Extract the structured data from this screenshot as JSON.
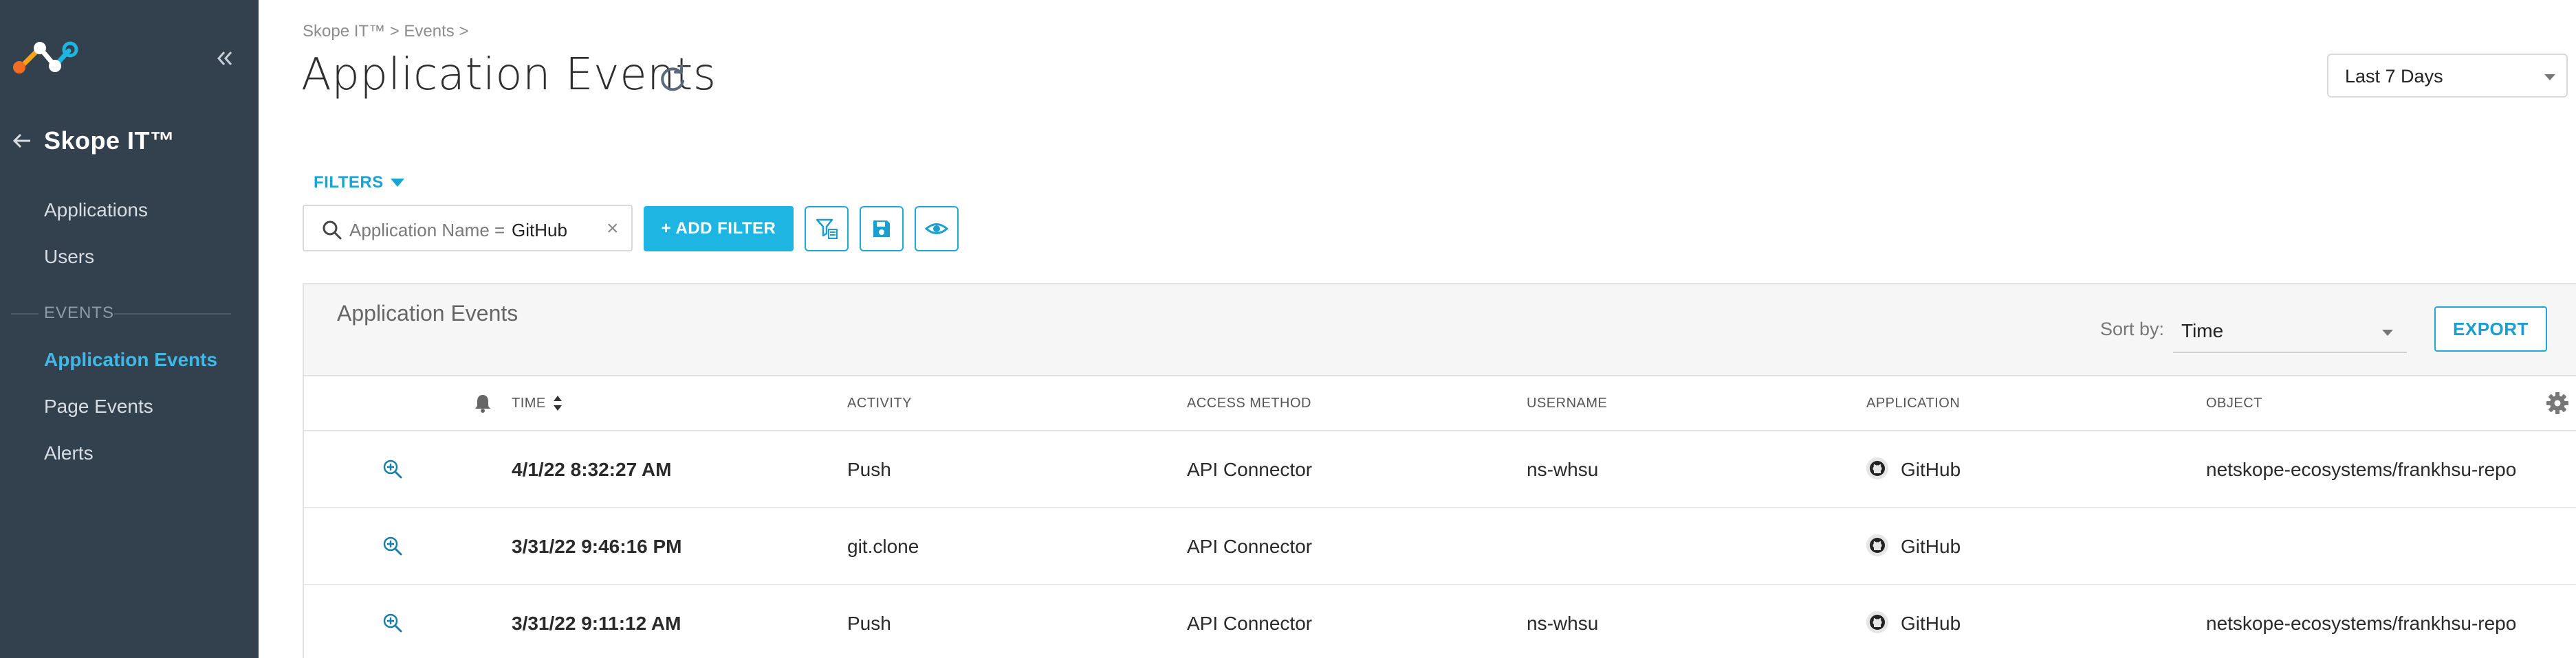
{
  "sidebar": {
    "back_title": "Skope IT™",
    "items_top": [
      {
        "label": "Applications"
      },
      {
        "label": "Users"
      }
    ],
    "section_label": "EVENTS",
    "items_events": [
      {
        "label": "Application Events",
        "active": true
      },
      {
        "label": "Page Events",
        "active": false
      },
      {
        "label": "Alerts",
        "active": false
      }
    ]
  },
  "header": {
    "breadcrumb": "Skope IT™ > Events >",
    "title": "Application Events",
    "range": "Last 7 Days"
  },
  "filters": {
    "toggle_label": "FILTERS",
    "chip_key": "Application Name =",
    "chip_value": "GitHub",
    "chip_close": "×",
    "add_label": "+ ADD FILTER"
  },
  "panel": {
    "title": "Application Events",
    "sort_label": "Sort by:",
    "sort_value": "Time",
    "export_label": "EXPORT",
    "columns": [
      "TIME",
      "ACTIVITY",
      "ACCESS METHOD",
      "USERNAME",
      "APPLICATION",
      "OBJECT"
    ],
    "rows": [
      {
        "time": "4/1/22 8:32:27 AM",
        "activity": "Push",
        "access": "API Connector",
        "username": "ns-whsu",
        "application": "GitHub",
        "object": "netskope-ecosystems/frankhsu-repo"
      },
      {
        "time": "3/31/22 9:46:16 PM",
        "activity": "git.clone",
        "access": "API Connector",
        "username": "",
        "application": "GitHub",
        "object": ""
      },
      {
        "time": "3/31/22 9:11:12 AM",
        "activity": "Push",
        "access": "API Connector",
        "username": "ns-whsu",
        "application": "GitHub",
        "object": "netskope-ecosystems/frankhsu-repo"
      }
    ]
  },
  "colors": {
    "sidebar_bg": "#33404d",
    "accent": "#1fb5e3",
    "active_nav": "#3fb9e5"
  }
}
